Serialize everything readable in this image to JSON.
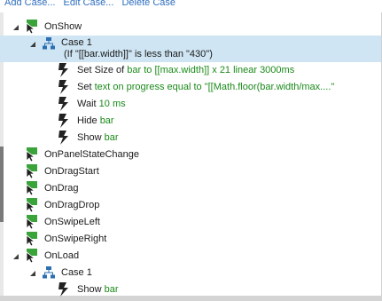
{
  "toolbar": {
    "add_case": "Add Case...",
    "edit_case": "Edit Case...",
    "delete_case": "Delete Case"
  },
  "events": {
    "on_show": "OnShow",
    "on_panel_state_change": "OnPanelStateChange",
    "on_drag_start": "OnDragStart",
    "on_drag": "OnDrag",
    "on_drag_drop": "OnDragDrop",
    "on_swipe_left": "OnSwipeLeft",
    "on_swipe_right": "OnSwipeRight",
    "on_load": "OnLoad"
  },
  "show_case": {
    "title": "Case 1",
    "condition": "(If \"[[bar.width]]\" is less than \"430\")",
    "actions": [
      {
        "verb": "Set Size of",
        "target": "bar",
        "rest": "to [[max.width]] x 21 linear 3000ms"
      },
      {
        "verb": "Set",
        "target": "text on progress",
        "rest": "equal to \"[[Math.floor(bar.width/max....\""
      },
      {
        "verb": "Wait",
        "target": "10 ms",
        "rest": ""
      },
      {
        "verb": "Hide",
        "target": "bar",
        "rest": ""
      },
      {
        "verb": "Show",
        "target": "bar",
        "rest": ""
      }
    ]
  },
  "load_case": {
    "title": "Case 1",
    "actions": [
      {
        "verb": "Show",
        "target": "bar",
        "rest": ""
      }
    ]
  },
  "colors": {
    "link": "#2f6fbf",
    "selected_row": "#cfe5f3",
    "event_green": "#3aa33a",
    "target_green": "#1a8a1a",
    "case_blue": "#2b6fb0"
  },
  "icons": {
    "event": "cursor-flag-icon",
    "case": "org-chart-icon",
    "action": "lightning-bolt-icon"
  }
}
